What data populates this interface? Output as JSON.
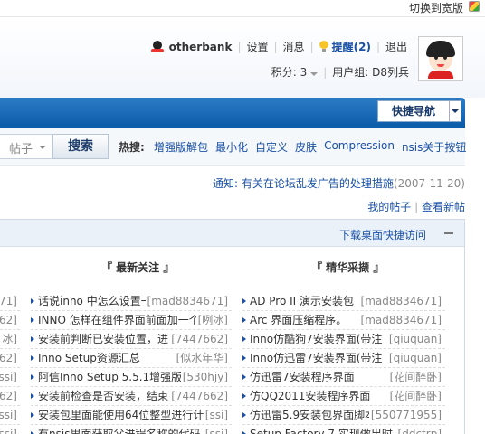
{
  "top": {
    "switch_wide": "切换到宽版"
  },
  "user": {
    "name": "otherbank",
    "settings": "设置",
    "messages": "消息",
    "remind": "提醒(2)",
    "logout": "退出",
    "score": "积分: 3",
    "group": "用户组: D8列兵"
  },
  "nav": {
    "quicknav": "快捷导航"
  },
  "search": {
    "scope": "帖子",
    "button": "搜索",
    "hot_label": "热搜:",
    "hot": [
      "增强版解包",
      "最小化",
      "自定义",
      "皮肤",
      "Compression",
      "nsis关于按钮"
    ]
  },
  "notice": {
    "label": "通知:",
    "text": "有关在论坛乱发广告的处理措施",
    "date": "(2007-11-20)"
  },
  "my": {
    "posts": "我的帖子",
    "sep": " | ",
    "newest": "查看新帖"
  },
  "panel": {
    "desk_link": "下载桌面快捷访问",
    "col1_title": "『 最新关注 』",
    "col2_title": "『 精华采撷 』",
    "leftcut": [
      "671]",
      "662]",
      "冰]",
      "662]",
      "ssi]",
      "662]",
      "ssi]",
      "ssi]"
    ],
    "latest": [
      {
        "title": "话说inno 中怎么设置一",
        "author": "[mad8834671]"
      },
      {
        "title": "INNO 怎样在组件界面前面加一个",
        "author": "[咧冰]"
      },
      {
        "title": "安装前判断已安装位置，进",
        "author": "[7447662]"
      },
      {
        "title": "Inno Setup资源汇总",
        "author": "[似水年华]"
      },
      {
        "title": "阿信Inno Setup 5.5.1增强版",
        "author": "[530hjy]"
      },
      {
        "title": "安装前检查是否安装，结束",
        "author": "[7447662]"
      },
      {
        "title": "安装包里面能使用64位整型进行计",
        "author": "[ssi]"
      },
      {
        "title": "有nsis里面获取父进程名称的代码",
        "author": "[ssi]"
      }
    ],
    "featured": [
      {
        "title": "AD Pro II 演示安装包",
        "author": "[mad8834671]"
      },
      {
        "title": "Arc 界面压缩程序。",
        "author": "[mad8834671]"
      },
      {
        "title": "Inno仿酷狗7安装界面(带注",
        "author": "[qiuquan]"
      },
      {
        "title": "Inno仿迅雷7安装界面(带注",
        "author": "[qiuquan]"
      },
      {
        "title": "仿迅雷7安装程序界面",
        "author": "[花间醉卧]"
      },
      {
        "title": "仿QQ2011安装程序界面",
        "author": "[花间醉卧]"
      },
      {
        "title": "仿迅雷5.9安装包界面脚本",
        "author": "[550771955]"
      },
      {
        "title": "Setup Factory 7 实现做出时",
        "author": "[ddctrp]"
      }
    ]
  }
}
